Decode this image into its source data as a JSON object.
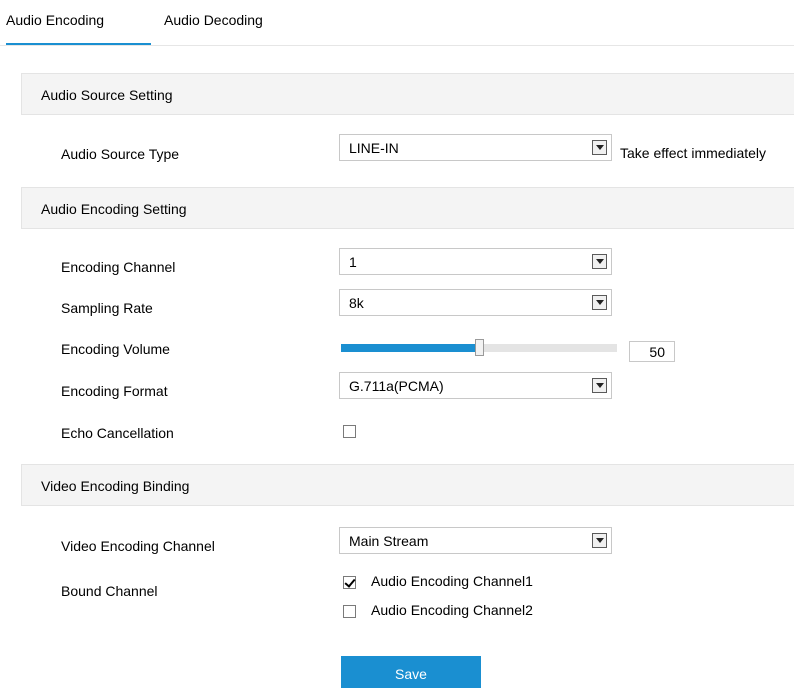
{
  "tabs": [
    {
      "label": "Audio Encoding",
      "active": true
    },
    {
      "label": "Audio Decoding",
      "active": false
    }
  ],
  "sections": {
    "audio_source": {
      "title": "Audio Source Setting",
      "source_type": {
        "label": "Audio Source Type",
        "value": "LINE-IN",
        "note": "Take effect immediately"
      }
    },
    "audio_encoding": {
      "title": "Audio Encoding Setting",
      "encoding_channel": {
        "label": "Encoding Channel",
        "value": "1"
      },
      "sampling_rate": {
        "label": "Sampling Rate",
        "value": "8k"
      },
      "encoding_volume": {
        "label": "Encoding Volume",
        "value": "50",
        "level_fraction": 0.5
      },
      "encoding_format": {
        "label": "Encoding Format",
        "value": "G.711a(PCMA)"
      },
      "echo_cancellation": {
        "label": "Echo Cancellation",
        "checked": false
      }
    },
    "video_binding": {
      "title": "Video Encoding Binding",
      "video_channel": {
        "label": "Video Encoding Channel",
        "value": "Main Stream"
      },
      "bound_channel": {
        "label": "Bound Channel",
        "options": [
          {
            "label": "Audio Encoding Channel1",
            "checked": true
          },
          {
            "label": "Audio Encoding Channel2",
            "checked": false
          }
        ]
      }
    }
  },
  "save_label": "Save",
  "colors": {
    "accent": "#1a8fd1",
    "section_bg": "#f4f4f4"
  },
  "icons": {
    "dropdown": "chevron-down-icon",
    "checkbox": "checkbox-icon"
  }
}
